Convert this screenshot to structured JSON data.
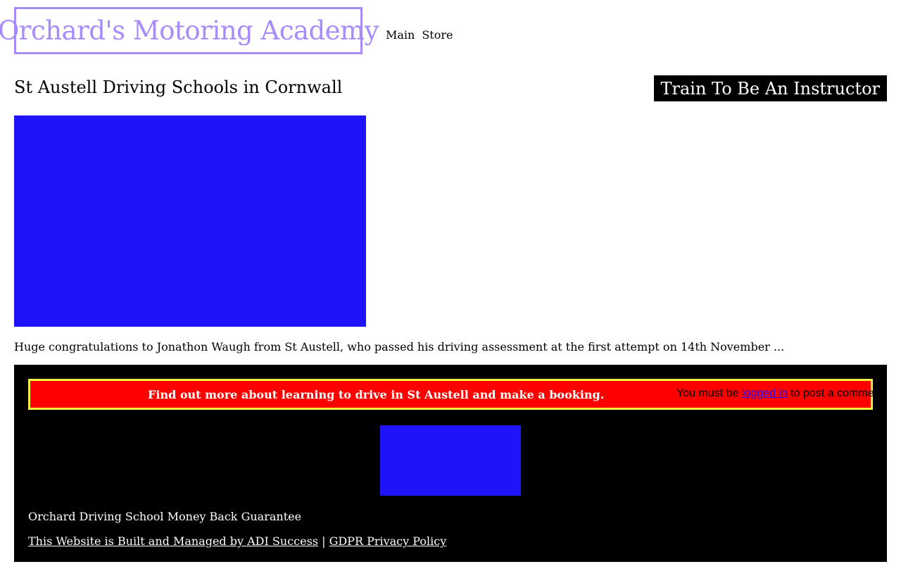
{
  "header": {
    "logo_text": "Orchard's Motoring Academy",
    "nav": [
      {
        "label": "Main"
      },
      {
        "label": "Store"
      }
    ]
  },
  "main": {
    "page_title": "St Austell Driving Schools in Cornwall",
    "instructor_button": "Train To Be An Instructor",
    "excerpt": "Huge congratulations to Jonathon Waugh from St Austell, who passed his driving assessment at the first attempt on 14th November ..."
  },
  "footer": {
    "booking_banner": "Find out more about learning to drive in St Austell and make a booking.",
    "comment_prefix": "You must be ",
    "comment_link": "logged in",
    "comment_suffix": " to post a comment.",
    "guarantee": "Orchard Driving School Money Back Guarantee",
    "credit_link": "This Website is Built and Managed by ADI Success",
    "separator": " | ",
    "privacy_link": "GDPR Privacy Policy"
  },
  "colors": {
    "logo": "#a78bfa",
    "image_placeholder": "#1e14f7",
    "banner_bg": "#ff0000",
    "banner_border": "#f5f53d",
    "footer_bg": "#000000"
  }
}
